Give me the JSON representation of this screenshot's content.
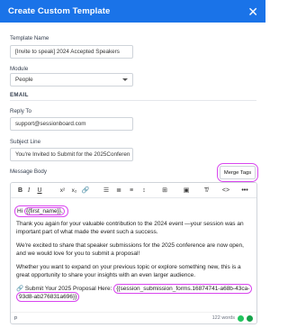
{
  "header": {
    "title": "Create Custom Template"
  },
  "template_name": {
    "label": "Template Name",
    "value": "[Invite to speak] 2024 Accepted Speakers"
  },
  "module": {
    "label": "Module",
    "value": "People"
  },
  "email_section": {
    "title": "EMAIL"
  },
  "reply_to": {
    "label": "Reply To",
    "value": "support@sessionboard.com"
  },
  "subject": {
    "label": "Subject Line",
    "value": "You're Invited to Submit for the 2025Conferen"
  },
  "message": {
    "label": "Message Body",
    "merge_tags_label": "Merge Tags",
    "toolbar": {
      "bold": "B",
      "italic": "I",
      "underline": "U",
      "superscript": "x²",
      "subscript": "x₂",
      "link": "🔗",
      "bullet_list": "☰",
      "ordered_list": "≣",
      "align": "≡",
      "line_height": "↕",
      "table": "⊞",
      "image": "▣",
      "clear_format": "T̸",
      "code": "<>",
      "more": "•••"
    },
    "greeting_prefix": "Hi ",
    "first_name_tag": "{{first_name}},",
    "p1": "Thank you again for your valuable contribution to the 2024 event —your session was an important part of what made the event such a success.",
    "p2": "We're excited to share that speaker submissions for the 2025 conference are now open, and we would love for you to submit a proposal!",
    "p3": "Whether you want to expand on your previous topic or explore something new, this is a great opportunity to share your insights with an even larger audience.",
    "link_icon": "🔗",
    "link_prefix": "Submit Your 2025 Proposal Here: ",
    "link_tag": "{{session_submission_forms.16874741-a68b-43ca-93d8-ab276831a696}}"
  },
  "footer": {
    "element": "p",
    "word_count": "122 words"
  },
  "colors": {
    "header": "#1a73e8",
    "highlight": "#d946ef"
  }
}
